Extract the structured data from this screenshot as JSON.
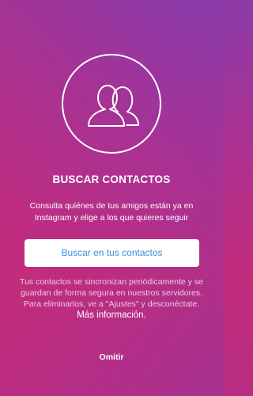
{
  "title": "BUSCAR CONTACTOS",
  "description": "Consulta quiénes de tus amigos están ya en Instagram y elige a los que quieres seguir",
  "primary_button_label": "Buscar en tus contactos",
  "note_text": "Tus contactos se sincronizan periódicamente y se guardan de forma segura en nuestros servidores. Para eliminarlos, ve a \"Ajustes\" y desconéctate.",
  "more_info_link": "Más información.",
  "skip_label": "Omitir",
  "icon": "people-icon",
  "colors": {
    "background_top": "#8b3aa8",
    "background_bottom": "#c22c7d",
    "button_text": "#3d8fd6"
  }
}
